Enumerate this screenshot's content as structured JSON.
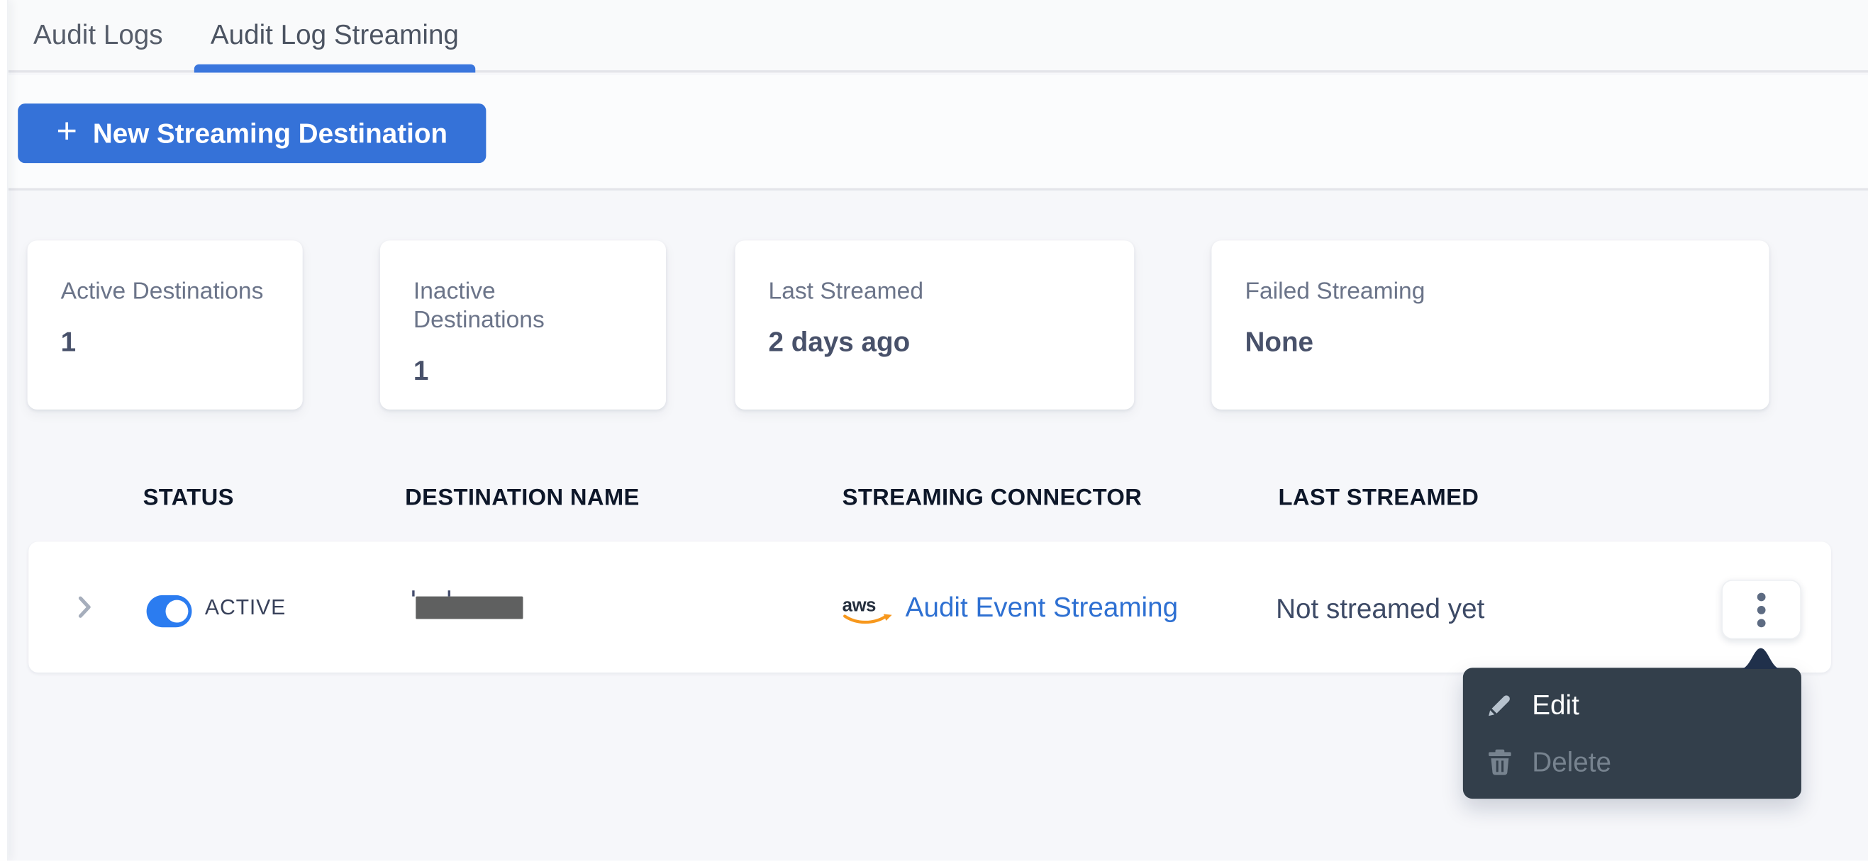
{
  "tabs": {
    "items": [
      {
        "label": "Audit Logs",
        "active": false
      },
      {
        "label": "Audit Log Streaming",
        "active": true
      }
    ]
  },
  "toolbar": {
    "new_button_label": "New Streaming Destination",
    "plus_glyph": "+"
  },
  "stats": {
    "cards": [
      {
        "label": "Active Destinations",
        "value": "1"
      },
      {
        "label": "Inactive Destinations",
        "value": "1"
      },
      {
        "label": "Last Streamed",
        "value": "2 days ago"
      },
      {
        "label": "Failed Streaming",
        "value": "None"
      }
    ]
  },
  "table": {
    "columns": [
      {
        "label": "STATUS"
      },
      {
        "label": "DESTINATION NAME"
      },
      {
        "label": "STREAMING CONNECTOR"
      },
      {
        "label": "LAST STREAMED"
      }
    ],
    "row": {
      "status_toggle": "on",
      "status_label": "ACTIVE",
      "destination_name_redacted": true,
      "connector_brand": "aws",
      "connector_label": "Audit Event Streaming",
      "last_streamed": "Not streamed yet"
    }
  },
  "context_menu": {
    "items": [
      {
        "label": "Edit",
        "icon": "pencil-icon",
        "enabled": true
      },
      {
        "label": "Delete",
        "icon": "trash-icon",
        "enabled": false
      }
    ]
  },
  "colors": {
    "accent_blue": "#3572d8",
    "tab_underline_blue": "#3a76dd",
    "toggle_blue": "#2b7cf0",
    "link_blue": "#2e70d2",
    "aws_orange": "#f7981d",
    "menu_bg": "#333f4b",
    "menu_arrow_navy": "#20304b",
    "menu_disabled_gray": "#77838f",
    "redaction_gray": "#5f6060"
  }
}
